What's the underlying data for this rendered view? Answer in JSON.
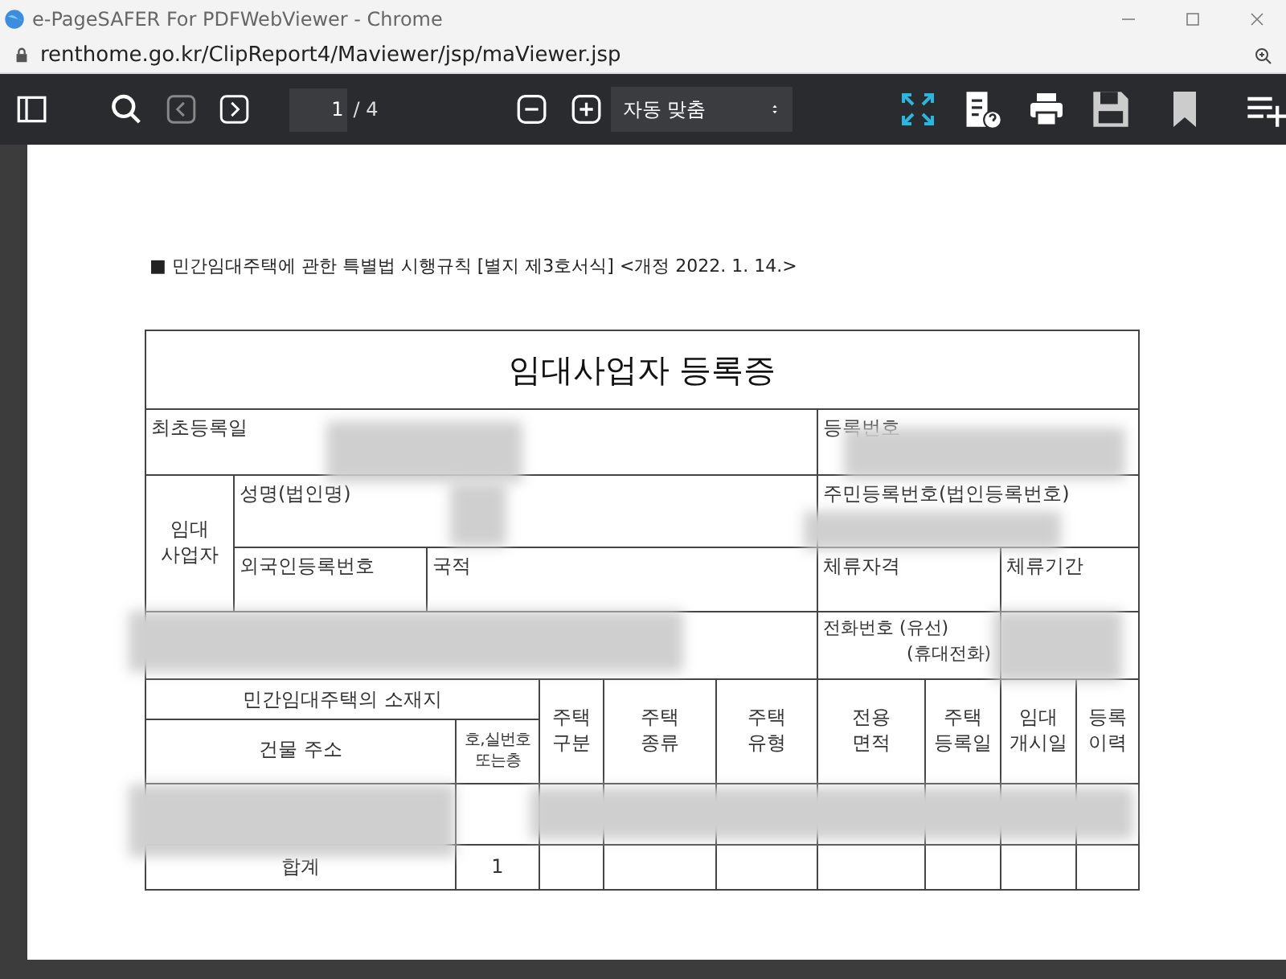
{
  "window": {
    "title": "e-PageSAFER For PDFWebViewer - Chrome"
  },
  "address_bar": {
    "url": "renthome.go.kr/ClipReport4/Maviewer/jsp/maViewer.jsp"
  },
  "toolbar": {
    "previous_page": {
      "disabled": true
    },
    "next_page": {
      "disabled": false
    },
    "page_number": "1",
    "page_total": "/ 4",
    "zoom": "자동 맞춤"
  },
  "document": {
    "header_note": "■ 민간임대주택에 관한 특별법 시행규칙 [별지 제3호서식] <개정 2022. 1. 14.>",
    "title": "임대사업자 등록증",
    "labels": [
      "최초등록일",
      "등록번호",
      "임대\n사업자",
      "성명(법인명)",
      "주민등록번호(법인등록번호)",
      "외국인등록번호",
      "국적",
      "체류자격",
      "체류기간",
      "전화번호 (유선)",
      "(휴대전화)"
    ],
    "location_header": "민간임대주택의 소재지",
    "columns": [
      "건물 주소",
      "호,실번호\n또는층",
      "주택\n구분",
      "주택\n종류",
      "주택\n유형",
      "전용\n면적",
      "주택\n등록일",
      "임대\n개시일",
      "등록\n이력"
    ],
    "total_row": {
      "label": "합계",
      "count": "1"
    }
  }
}
